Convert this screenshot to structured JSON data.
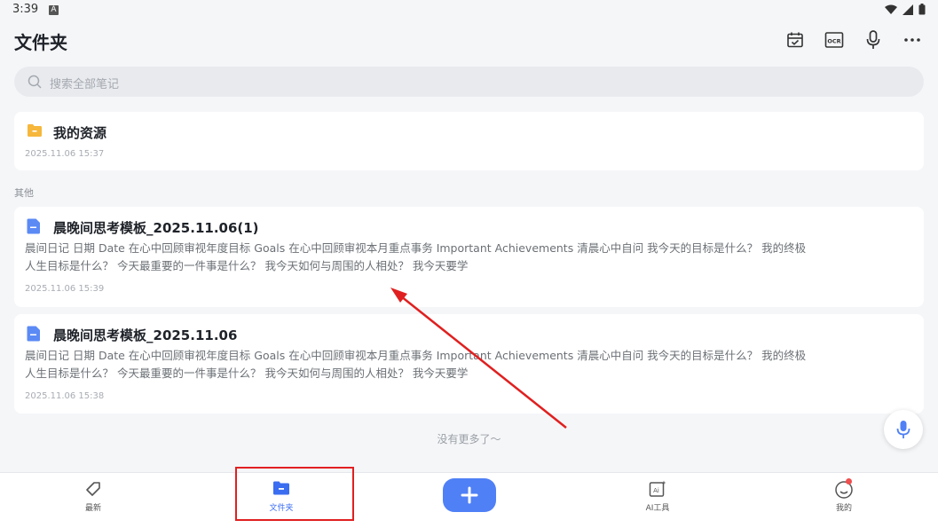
{
  "status_bar": {
    "time": "3:39",
    "notif_icon_letter": "A"
  },
  "header": {
    "title": "文件夹"
  },
  "toolbar": {
    "buttons": [
      {
        "icon": "calendar-check-icon"
      },
      {
        "icon": "ocr-icon",
        "label": "OCR"
      },
      {
        "icon": "microphone-icon"
      },
      {
        "icon": "more-icon"
      }
    ]
  },
  "search": {
    "placeholder": "搜索全部笔记"
  },
  "folder": {
    "title": "我的资源",
    "date": "2025.11.06 15:37"
  },
  "section_label": "其他",
  "notes": [
    {
      "title": "晨晚间思考模板_2025.11.06(1)",
      "excerpt_line1": "晨间日记    日期    Date  在心中回顾审视年度目标    Goals  在心中回顾审视本月重点事务    Important Achievements 清晨心中自问 我今天的目标是什么？ 我的终极",
      "excerpt_line2": "人生目标是什么？ 今天最重要的一件事是什么？ 我今天如何与周围的人相处？ 我今天要学",
      "date": "2025.11.06 15:39"
    },
    {
      "title": "晨晚间思考模板_2025.11.06",
      "excerpt_line1": "晨间日记    日期    Date  在心中回顾审视年度目标    Goals  在心中回顾审视本月重点事务    Important Achievements 清晨心中自问 我今天的目标是什么？ 我的终极",
      "excerpt_line2": "人生目标是什么？ 今天最重要的一件事是什么？ 我今天如何与周围的人相处？ 我今天要学",
      "date": "2025.11.06 15:38"
    }
  ],
  "end_text": "没有更多了～",
  "bottom_nav": {
    "tabs": [
      {
        "label": "最新",
        "icon": "tag-icon"
      },
      {
        "label": "文件夹",
        "icon": "folder-icon",
        "active": true
      },
      {
        "label": "",
        "icon": "add-icon"
      },
      {
        "label": "AI工具",
        "icon": "ai-icon"
      },
      {
        "label": "我的",
        "icon": "profile-icon"
      }
    ]
  },
  "colors": {
    "accent": "#4f80f6",
    "annotation": "#e02020",
    "folder": "#f6b73c",
    "note_icon": "#5b8af5"
  }
}
